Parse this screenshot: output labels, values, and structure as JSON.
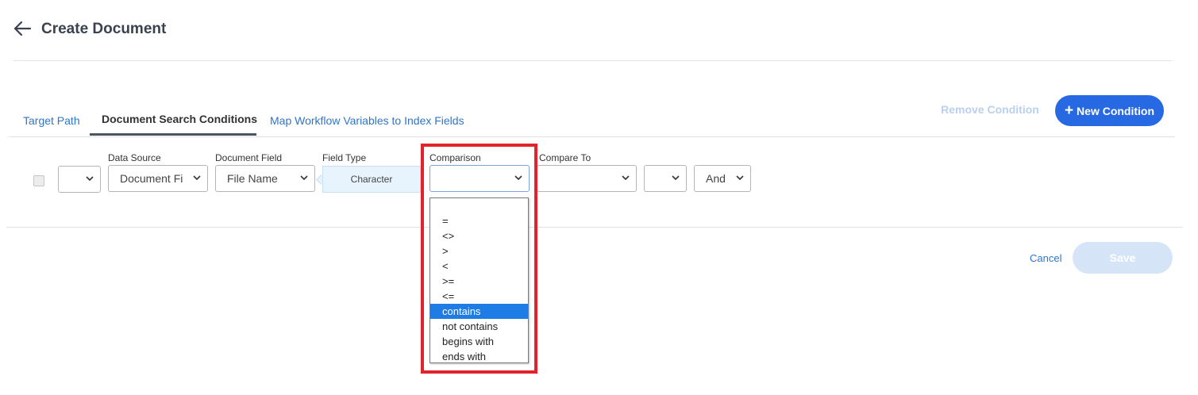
{
  "header": {
    "title": "Create Document",
    "back_icon": "arrow-left-icon"
  },
  "tabs": [
    {
      "label": "Target Path",
      "active": false
    },
    {
      "label": "Document Search Conditions",
      "active": true
    },
    {
      "label": "Map Workflow Variables to Index Fields",
      "active": false
    }
  ],
  "actions": {
    "remove_condition": "Remove Condition",
    "new_condition": "New Condition",
    "new_icon": "plus-icon"
  },
  "condition": {
    "checked": false,
    "paren_open": "",
    "data_source": {
      "label": "Data Source",
      "value": "Document Fi"
    },
    "document_field": {
      "label": "Document Field",
      "value": "File Name"
    },
    "field_type": {
      "label": "Field Type",
      "value": "Character"
    },
    "comparison": {
      "label": "Comparison",
      "value": ""
    },
    "compare_to": {
      "label": "Compare To",
      "value": ""
    },
    "paren_close": "",
    "logic": {
      "value": "And"
    }
  },
  "comparison_options": [
    "",
    "=",
    "<>",
    ">",
    "<",
    ">=",
    "<=",
    "contains",
    "not contains",
    "begins with",
    "ends with"
  ],
  "comparison_highlighted_index": 7,
  "footer": {
    "cancel": "Cancel",
    "save": "Save"
  },
  "colors": {
    "primary": "#2768e3",
    "link": "#2f76c8",
    "highlight_border": "#e3232c",
    "selected_option": "#1e7ce6"
  }
}
